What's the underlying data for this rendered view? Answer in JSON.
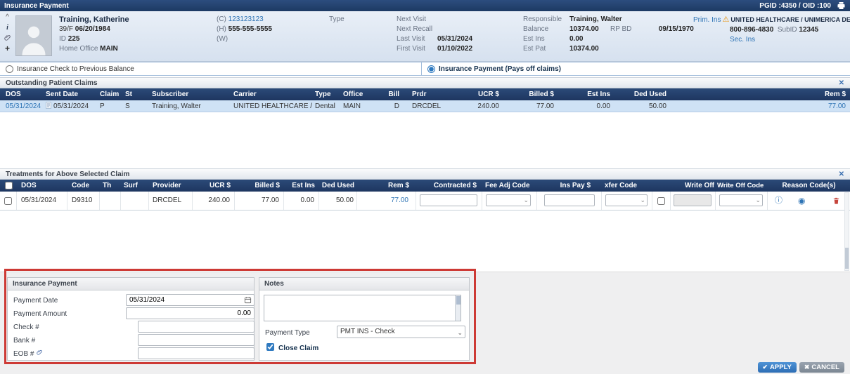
{
  "colors": {
    "accent_blue": "#2f7ac0",
    "header_navy": "#1f3864",
    "link_blue": "#2e74b5",
    "selected_row_blue": "#cfe2f5",
    "annotation_red": "#cd3a35",
    "warning_orange": "#e8930c"
  },
  "title_bar": {
    "title": "Insurance Payment",
    "pgid_oid": "PGID :4350 / OID :100"
  },
  "patient": {
    "name": "Training, Katherine",
    "age_sex": "39/F",
    "dob": "06/20/1984",
    "id_label": "ID",
    "id_value": "225",
    "home_office_label": "Home Office",
    "home_office": "MAIN",
    "cell_label": "(C)",
    "cell_phone": "123123123",
    "home_label": "(H)",
    "home_phone": "555-555-5555",
    "work_label": "(W)",
    "type_label": "Type",
    "next_visit_label": "Next Visit",
    "next_recall_label": "Next Recall",
    "last_visit_label": "Last Visit",
    "last_visit": "05/31/2024",
    "first_visit_label": "First Visit",
    "first_visit": "01/10/2022",
    "responsible_label": "Responsible",
    "responsible": "Training, Walter",
    "balance_label": "Balance",
    "balance": "10374.00",
    "rp_bd_label": "RP BD",
    "rp_bd": "09/15/1970",
    "est_ins_label": "Est Ins",
    "est_ins": "0.00",
    "est_pat_label": "Est Pat",
    "est_pat": "10374.00",
    "prim_ins_label": "Prim. Ins",
    "prim_carrier": "UNITED HEALTHCARE / UNIMERICA DENT.",
    "prim_phone": "800-896-4830",
    "subid_label": "SubID",
    "subid": "12345",
    "sec_ins_label": "Sec. Ins"
  },
  "mode": {
    "check_prev_label": "Insurance Check to Previous Balance",
    "payment_label": "Insurance Payment (Pays off claims)"
  },
  "claims": {
    "title": "Outstanding Patient Claims",
    "columns": [
      "DOS",
      "Sent Date",
      "Claim",
      "St",
      "Subscriber",
      "Carrier",
      "Type",
      "Office",
      "Bill",
      "Prdr",
      "UCR $",
      "Billed $",
      "Est Ins",
      "Ded Used",
      "Rem $"
    ],
    "row": {
      "dos": "05/31/2024",
      "sent_date": "05/31/2024",
      "claim": "P",
      "st": "S",
      "subscriber": "Training, Walter",
      "carrier": "UNITED HEALTHCARE / U...",
      "type": "Dental",
      "office": "MAIN",
      "bill": "D",
      "prdr": "DRCDEL",
      "ucr": "240.00",
      "billed": "77.00",
      "est_ins": "0.00",
      "ded_used": "50.00",
      "rem": "77.00"
    }
  },
  "treatments": {
    "title": "Treatments for Above Selected Claim",
    "columns": [
      "DOS",
      "Code",
      "Th",
      "Surf",
      "Provider",
      "UCR $",
      "Billed $",
      "Est Ins",
      "Ded Used",
      "Rem $",
      "Contracted $",
      "Fee Adj Code",
      "Ins Pay $",
      "xfer Code",
      "Write Off",
      "Write Off Code",
      "Reason Code(s)"
    ],
    "row": {
      "dos": "05/31/2024",
      "code": "D9310",
      "th": "",
      "surf": "",
      "provider": "DRCDEL",
      "ucr": "240.00",
      "billed": "77.00",
      "est_ins": "0.00",
      "ded_used": "50.00",
      "rem": "77.00",
      "contracted": "",
      "fee_adj_code": "",
      "ins_pay": "",
      "xfer_code": "",
      "write_off": "",
      "write_off_code": ""
    }
  },
  "payment_panel": {
    "title": "Insurance Payment",
    "payment_date_label": "Payment Date",
    "payment_date": "05/31/2024",
    "payment_amount_label": "Payment Amount",
    "payment_amount": "0.00",
    "check_label": "Check #",
    "check_value": "",
    "bank_label": "Bank #",
    "bank_value": "",
    "eob_label": "EOB #",
    "eob_value": ""
  },
  "notes_panel": {
    "title": "Notes",
    "notes_value": "",
    "payment_type_label": "Payment Type",
    "payment_type_value": "PMT INS - Check",
    "close_claim_label": "Close Claim"
  },
  "footer": {
    "apply": "APPLY",
    "cancel": "CANCEL"
  }
}
